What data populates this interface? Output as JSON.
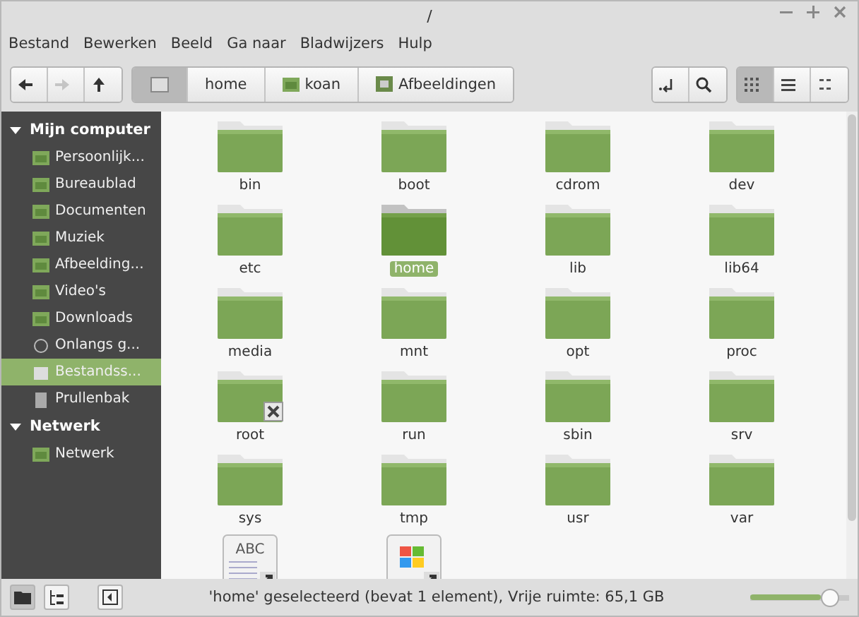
{
  "window": {
    "title": "/"
  },
  "menu": [
    "Bestand",
    "Bewerken",
    "Beeld",
    "Ga naar",
    "Bladwijzers",
    "Hulp"
  ],
  "nav_buttons": [
    {
      "kind": "back",
      "disabled": false
    },
    {
      "kind": "forward",
      "disabled": true
    },
    {
      "kind": "up",
      "disabled": false
    }
  ],
  "breadcrumbs": [
    {
      "kind": "drive",
      "selected": true
    },
    {
      "kind": "plain",
      "label": "home",
      "selected": false
    },
    {
      "kind": "folder",
      "label": "koan",
      "selected": false
    },
    {
      "kind": "pictures",
      "label": "Afbeeldingen",
      "selected": false
    }
  ],
  "view_buttons": [
    {
      "kind": "icons",
      "selected": true
    },
    {
      "kind": "list",
      "selected": false
    },
    {
      "kind": "compact",
      "selected": false
    }
  ],
  "sidebar": [
    {
      "label": "Mijn computer",
      "expanded": true,
      "children": [
        {
          "label": "Persoonlijk...",
          "selected": false
        },
        {
          "label": "Bureaublad",
          "selected": false
        },
        {
          "label": "Documenten",
          "selected": false
        },
        {
          "label": "Muziek",
          "selected": false
        },
        {
          "label": "Afbeelding...",
          "selected": false
        },
        {
          "label": "Video's",
          "selected": false
        },
        {
          "label": "Downloads",
          "selected": false
        },
        {
          "label": "Onlangs g...",
          "selected": false
        },
        {
          "label": "Bestandss...",
          "selected": true
        },
        {
          "label": "Prullenbak",
          "selected": false
        }
      ]
    },
    {
      "label": "Netwerk",
      "expanded": true,
      "children": [
        {
          "label": "Netwerk",
          "selected": false
        }
      ]
    }
  ],
  "files": [
    {
      "name": "bin",
      "kind": "folder",
      "selected": false
    },
    {
      "name": "boot",
      "kind": "folder",
      "selected": false
    },
    {
      "name": "cdrom",
      "kind": "folder",
      "selected": false
    },
    {
      "name": "dev",
      "kind": "folder",
      "selected": false
    },
    {
      "name": "etc",
      "kind": "folder",
      "selected": false
    },
    {
      "name": "home",
      "kind": "folder",
      "selected": true
    },
    {
      "name": "lib",
      "kind": "folder",
      "selected": false
    },
    {
      "name": "lib64",
      "kind": "folder",
      "selected": false
    },
    {
      "name": "media",
      "kind": "folder",
      "selected": false
    },
    {
      "name": "mnt",
      "kind": "folder",
      "selected": false
    },
    {
      "name": "opt",
      "kind": "folder",
      "selected": false
    },
    {
      "name": "proc",
      "kind": "folder",
      "selected": false
    },
    {
      "name": "root",
      "kind": "locked-folder",
      "selected": false
    },
    {
      "name": "run",
      "kind": "folder",
      "selected": false
    },
    {
      "name": "sbin",
      "kind": "folder",
      "selected": false
    },
    {
      "name": "srv",
      "kind": "folder",
      "selected": false
    },
    {
      "name": "sys",
      "kind": "folder",
      "selected": false
    },
    {
      "name": "tmp",
      "kind": "folder",
      "selected": false
    },
    {
      "name": "usr",
      "kind": "folder",
      "selected": false
    },
    {
      "name": "var",
      "kind": "folder",
      "selected": false
    },
    {
      "kind": "text-link",
      "icon_text": "ABC",
      "selected": false
    },
    {
      "kind": "windows-link",
      "selected": false
    }
  ],
  "status_bar": {
    "text": "'home' geselecteerd (bevat 1 element), Vrije ruimte: 65,1 GB",
    "zoom": {
      "level": 0.72
    }
  }
}
